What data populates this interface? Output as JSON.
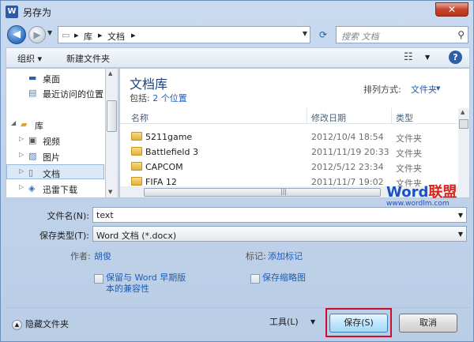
{
  "window": {
    "title": "另存为",
    "app_icon": "W",
    "close_glyph": "✕"
  },
  "address": {
    "breadcrumbs": [
      "库",
      "文档"
    ],
    "search_placeholder": "搜索 文档"
  },
  "toolbar": {
    "organize_label": "组织 ▾",
    "new_folder_label": "新建文件夹"
  },
  "nav": {
    "items": [
      {
        "label": "桌面",
        "icon": "desktop-icon"
      },
      {
        "label": "最近访问的位置",
        "icon": "recent-places-icon"
      },
      {
        "label": "库",
        "icon": "library-icon"
      },
      {
        "label": "视频",
        "icon": "video-icon"
      },
      {
        "label": "图片",
        "icon": "pictures-icon"
      },
      {
        "label": "文档",
        "icon": "documents-icon"
      },
      {
        "label": "迅雷下载",
        "icon": "thunder-download-icon"
      }
    ]
  },
  "files": {
    "library_title": "文档库",
    "includes_label": "包括:",
    "includes_link": "2 个位置",
    "arrange_label": "排列方式:",
    "arrange_value": "文件夹",
    "columns": {
      "name": "名称",
      "date": "修改日期",
      "type": "类型"
    },
    "rows": [
      {
        "name": "5211game",
        "date": "2012/10/4 18:54",
        "type": "文件夹"
      },
      {
        "name": "Battlefield 3",
        "date": "2011/11/19 20:33",
        "type": "文件夹"
      },
      {
        "name": "CAPCOM",
        "date": "2012/5/12 23:34",
        "type": "文件夹"
      },
      {
        "name": "FIFA 12",
        "date": "2011/11/7 19:02",
        "type": "文件夹"
      }
    ]
  },
  "watermark": {
    "brand_part1": "Word",
    "brand_part2": "联盟",
    "url": "www.wordlm.com"
  },
  "form": {
    "filename_label": "文件名(N):",
    "filename_value": "text",
    "filetype_label": "保存类型(T):",
    "filetype_value": "Word 文档 (*.docx)",
    "author_label": "作者:",
    "author_value": "胡俊",
    "tags_label": "标记:",
    "tags_value": "添加标记",
    "compat_line1": "保留与 Word 早期版",
    "compat_line2": "本的兼容性",
    "thumbnail_label": "保存缩略图"
  },
  "footer": {
    "hide_folders_label": "隐藏文件夹",
    "tools_label": "工具(L)",
    "save_label": "保存(S)",
    "cancel_label": "取消"
  },
  "colors": {
    "accent_link": "#1f5cb8",
    "highlight_box": "#c8102e",
    "close_button": "#c7452c"
  }
}
